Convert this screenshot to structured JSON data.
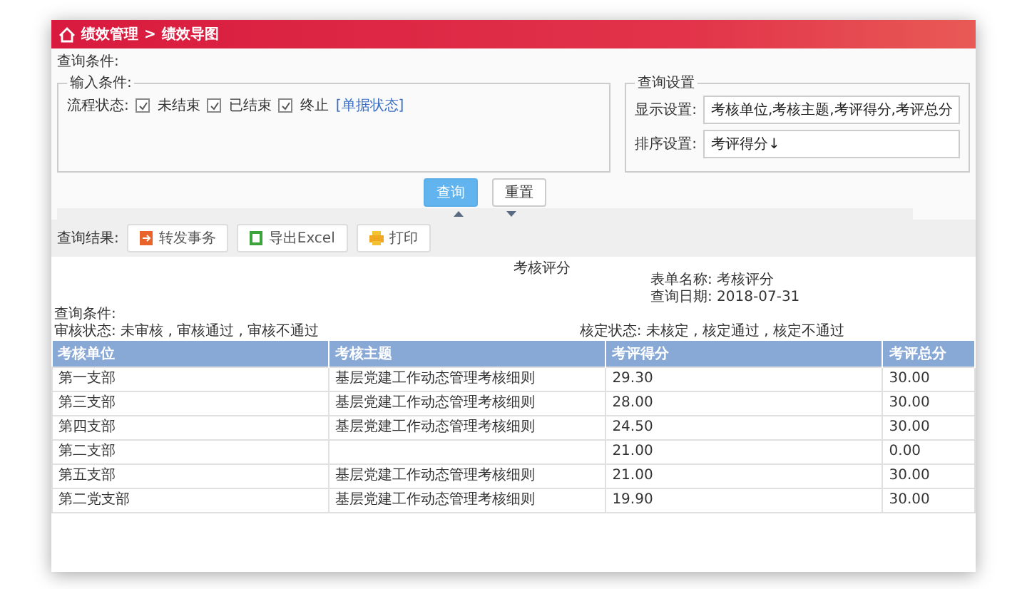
{
  "header": {
    "breadcrumb": [
      "绩效管理",
      "绩效导图"
    ],
    "separator": ">"
  },
  "query": {
    "label": "查询条件:",
    "input_legend": "输入条件:",
    "status_label": "流程状态:",
    "statuses": [
      {
        "label": "未结束",
        "checked": true
      },
      {
        "label": "已结束",
        "checked": true
      },
      {
        "label": "终止",
        "checked": true
      }
    ],
    "status_link": "[单据状态]",
    "settings_legend": "查询设置",
    "settings": [
      {
        "label": "显示设置:",
        "value": "考核单位,考核主题,考评得分,考评总分"
      },
      {
        "label": "排序设置:",
        "value": "考评得分↓"
      }
    ],
    "buttons": [
      {
        "label": "查询",
        "primary": true
      },
      {
        "label": "重置",
        "primary": false
      }
    ]
  },
  "toolbar": {
    "label": "查询结果:",
    "buttons": [
      {
        "label": "转发事务",
        "kind": "forward"
      },
      {
        "label": "导出Excel",
        "kind": "excel"
      },
      {
        "label": "打印",
        "kind": "print"
      }
    ]
  },
  "report": {
    "title": "考核评分",
    "form_name": "表单名称: 考核评分",
    "query_date": "查询日期: 2018-07-31",
    "conditions_label": "查询条件:",
    "audit_status": "审核状态: 未审核 , 审核通过 , 审核不通过",
    "approve_status": "核定状态: 未核定 , 核定通过 , 核定不通过"
  },
  "table": {
    "columns": [
      "考核单位",
      "考核主题",
      "考评得分",
      "考评总分"
    ],
    "rows": [
      [
        "第一支部",
        "基层党建工作动态管理考核细则",
        "29.30",
        "30.00"
      ],
      [
        "第三支部",
        "基层党建工作动态管理考核细则",
        "28.00",
        "30.00"
      ],
      [
        "第四支部",
        "基层党建工作动态管理考核细则",
        "24.50",
        "30.00"
      ],
      [
        "第二支部",
        "",
        "21.00",
        "0.00"
      ],
      [
        "第五支部",
        "基层党建工作动态管理考核细则",
        "21.00",
        "30.00"
      ],
      [
        "第二党支部",
        "基层党建工作动态管理考核细则",
        "19.90",
        "30.00"
      ]
    ]
  }
}
